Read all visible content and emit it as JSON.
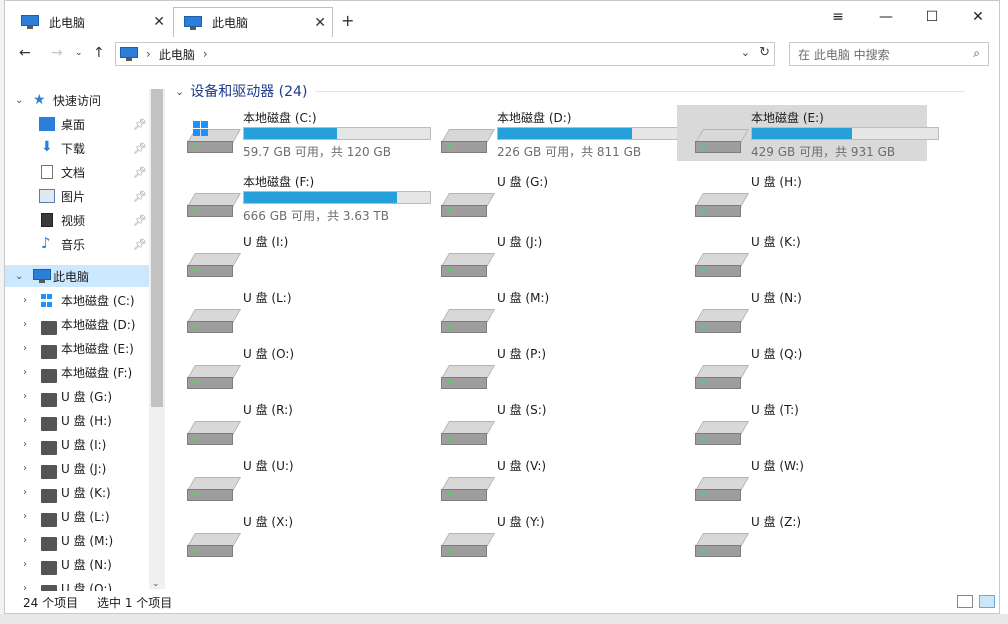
{
  "tabs": [
    {
      "title": "此电脑"
    },
    {
      "title": "此电脑"
    }
  ],
  "address": {
    "root": "此电脑"
  },
  "search": {
    "placeholder": "在 此电脑 中搜索"
  },
  "sidebar": {
    "quick_access": "快速访问",
    "pinned": [
      {
        "label": "桌面",
        "icon": "desktop-icon"
      },
      {
        "label": "下载",
        "icon": "download-icon"
      },
      {
        "label": "文档",
        "icon": "document-icon"
      },
      {
        "label": "图片",
        "icon": "pictures-icon"
      },
      {
        "label": "视频",
        "icon": "video-icon"
      },
      {
        "label": "音乐",
        "icon": "music-icon"
      }
    ],
    "this_pc": "此电脑",
    "drives": [
      "本地磁盘 (C:)",
      "本地磁盘 (D:)",
      "本地磁盘 (E:)",
      "本地磁盘 (F:)",
      "U 盘 (G:)",
      "U 盘 (H:)",
      "U 盘 (I:)",
      "U 盘 (J:)",
      "U 盘 (K:)",
      "U 盘 (L:)",
      "U 盘 (M:)",
      "U 盘 (N:)",
      "U 盘 (O:)"
    ]
  },
  "main": {
    "group_title": "设备和驱动器 (24)",
    "drives": [
      {
        "name": "本地磁盘 (C:)",
        "capacity": "59.7 GB 可用，共 120 GB",
        "used_fraction": 0.5
      },
      {
        "name": "本地磁盘 (D:)",
        "capacity": "226 GB 可用，共 811 GB",
        "used_fraction": 0.72
      },
      {
        "name": "本地磁盘 (E:)",
        "capacity": "429 GB 可用，共 931 GB",
        "used_fraction": 0.54
      },
      {
        "name": "本地磁盘 (F:)",
        "capacity": "666 GB 可用，共 3.63 TB",
        "used_fraction": 0.82
      },
      {
        "name": "U 盘 (G:)"
      },
      {
        "name": "U 盘 (H:)"
      },
      {
        "name": "U 盘 (I:)"
      },
      {
        "name": "U 盘 (J:)"
      },
      {
        "name": "U 盘 (K:)"
      },
      {
        "name": "U 盘 (L:)"
      },
      {
        "name": "U 盘 (M:)"
      },
      {
        "name": "U 盘 (N:)"
      },
      {
        "name": "U 盘 (O:)"
      },
      {
        "name": "U 盘 (P:)"
      },
      {
        "name": "U 盘 (Q:)"
      },
      {
        "name": "U 盘 (R:)"
      },
      {
        "name": "U 盘 (S:)"
      },
      {
        "name": "U 盘 (T:)"
      },
      {
        "name": "U 盘 (U:)"
      },
      {
        "name": "U 盘 (V:)"
      },
      {
        "name": "U 盘 (W:)"
      },
      {
        "name": "U 盘 (X:)"
      },
      {
        "name": "U 盘 (Y:)"
      },
      {
        "name": "U 盘 (Z:)"
      }
    ]
  },
  "status": {
    "count": "24 个项目",
    "selection": "选中 1 个项目"
  },
  "colors": {
    "accent": "#26a0da",
    "selection": "#cce8ff"
  }
}
